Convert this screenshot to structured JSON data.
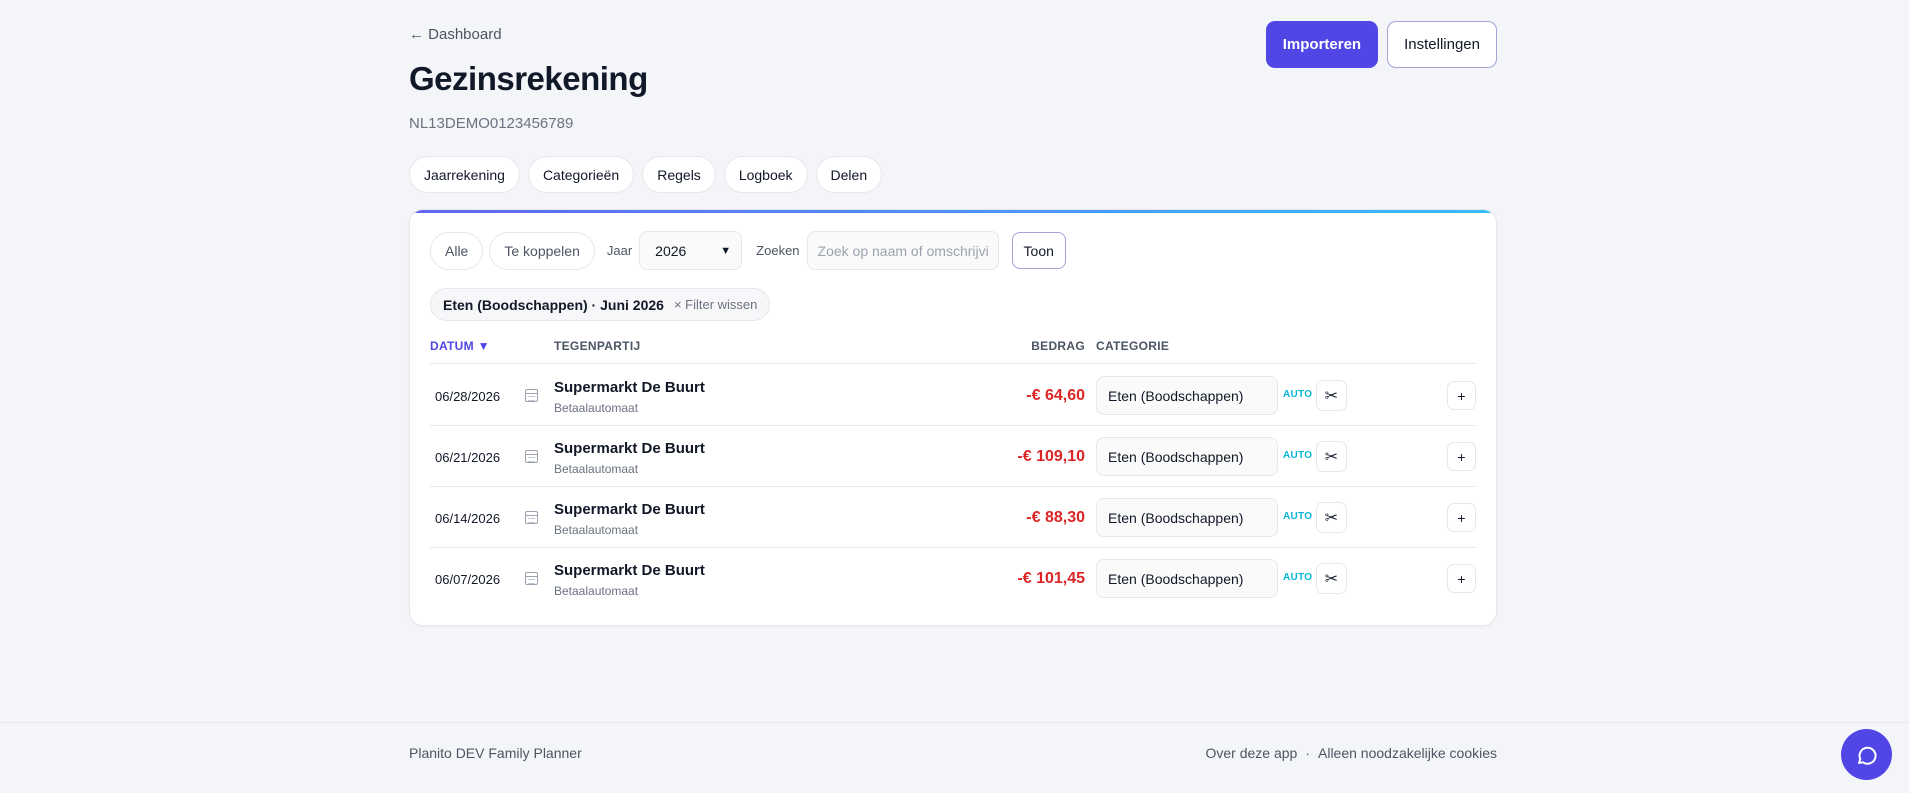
{
  "header": {
    "back_label": "← Dashboard",
    "title": "Gezinsrekening",
    "iban": "NL13DEMO0123456789",
    "import_label": "Importeren",
    "settings_label": "Instellingen"
  },
  "tabs": [
    {
      "label": "Jaarrekening"
    },
    {
      "label": "Categorieën"
    },
    {
      "label": "Regels"
    },
    {
      "label": "Logboek"
    },
    {
      "label": "Delen"
    }
  ],
  "filters": {
    "all_label": "Alle",
    "to_link_label": "Te koppelen",
    "year_label": "Jaar",
    "year_value": "2026",
    "search_label": "Zoeken",
    "search_placeholder": "Zoek op naam of omschrijving",
    "show_label": "Toon",
    "active_filter": "Eten (Boodschappen) · Juni 2026",
    "clear_label": "× Filter wissen"
  },
  "table": {
    "columns": {
      "date": "DATUM ▼",
      "counterparty": "TEGENPARTIJ",
      "amount": "BEDRAG",
      "category": "CATEGORIE"
    },
    "rows": [
      {
        "date": "06/28/2026",
        "name": "Supermarkt De Buurt",
        "sub": "Betaalautomaat",
        "amount": "-€ 64,60",
        "category": "Eten (Boodschappen)",
        "tag": "AUTO"
      },
      {
        "date": "06/21/2026",
        "name": "Supermarkt De Buurt",
        "sub": "Betaalautomaat",
        "amount": "-€ 109,10",
        "category": "Eten (Boodschappen)",
        "tag": "AUTO"
      },
      {
        "date": "06/14/2026",
        "name": "Supermarkt De Buurt",
        "sub": "Betaalautomaat",
        "amount": "-€ 88,30",
        "category": "Eten (Boodschappen)",
        "tag": "AUTO"
      },
      {
        "date": "06/07/2026",
        "name": "Supermarkt De Buurt",
        "sub": "Betaalautomaat",
        "amount": "-€ 101,45",
        "category": "Eten (Boodschappen)",
        "tag": "AUTO"
      }
    ]
  },
  "footer": {
    "left": "Planito DEV Family Planner",
    "about": "Over deze app",
    "separator": "·",
    "cookies": "Alleen noodzakelijke cookies"
  },
  "icons": {
    "split": "scissors-icon",
    "add": "plus-icon",
    "calendar": "calendar-icon",
    "chat": "chat-icon"
  },
  "colors": {
    "accent": "#4f46e5",
    "negative": "#dc2626",
    "auto_tag": "#06b6d4"
  }
}
